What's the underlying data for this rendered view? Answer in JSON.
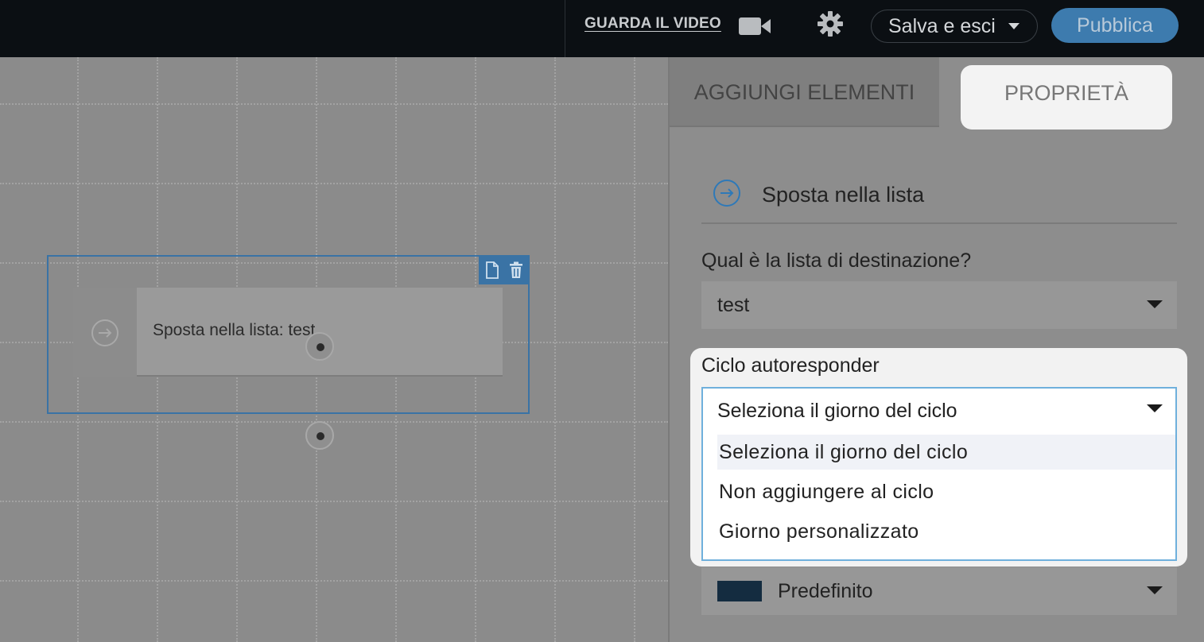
{
  "topbar": {
    "video_link": "GUARDA IL VIDEO",
    "save_exit_label": "Salva e esci",
    "publish_label": "Pubblica"
  },
  "canvas": {
    "node_label": "Sposta nella lista: test"
  },
  "panel": {
    "tabs": [
      {
        "label": "AGGIUNGI ELEMENTI",
        "active": false
      },
      {
        "label": "PROPRIETÀ",
        "active": true
      }
    ],
    "header_title": "Sposta nella lista",
    "destination_question": "Qual è la lista di destinazione?",
    "destination_value": "test",
    "autoresponder_label": "Ciclo autoresponder",
    "autoresponder_value": "Seleziona il giorno del ciclo",
    "autoresponder_options": [
      "Seleziona il giorno del ciclo",
      "Non aggiungere al ciclo",
      "Giorno personalizzato"
    ],
    "color_value": "Predefinito",
    "color_swatch": "#142c40"
  },
  "colors": {
    "accent": "#3a73a5",
    "publish": "#3d7bae",
    "topbar": "#0b0f13"
  }
}
